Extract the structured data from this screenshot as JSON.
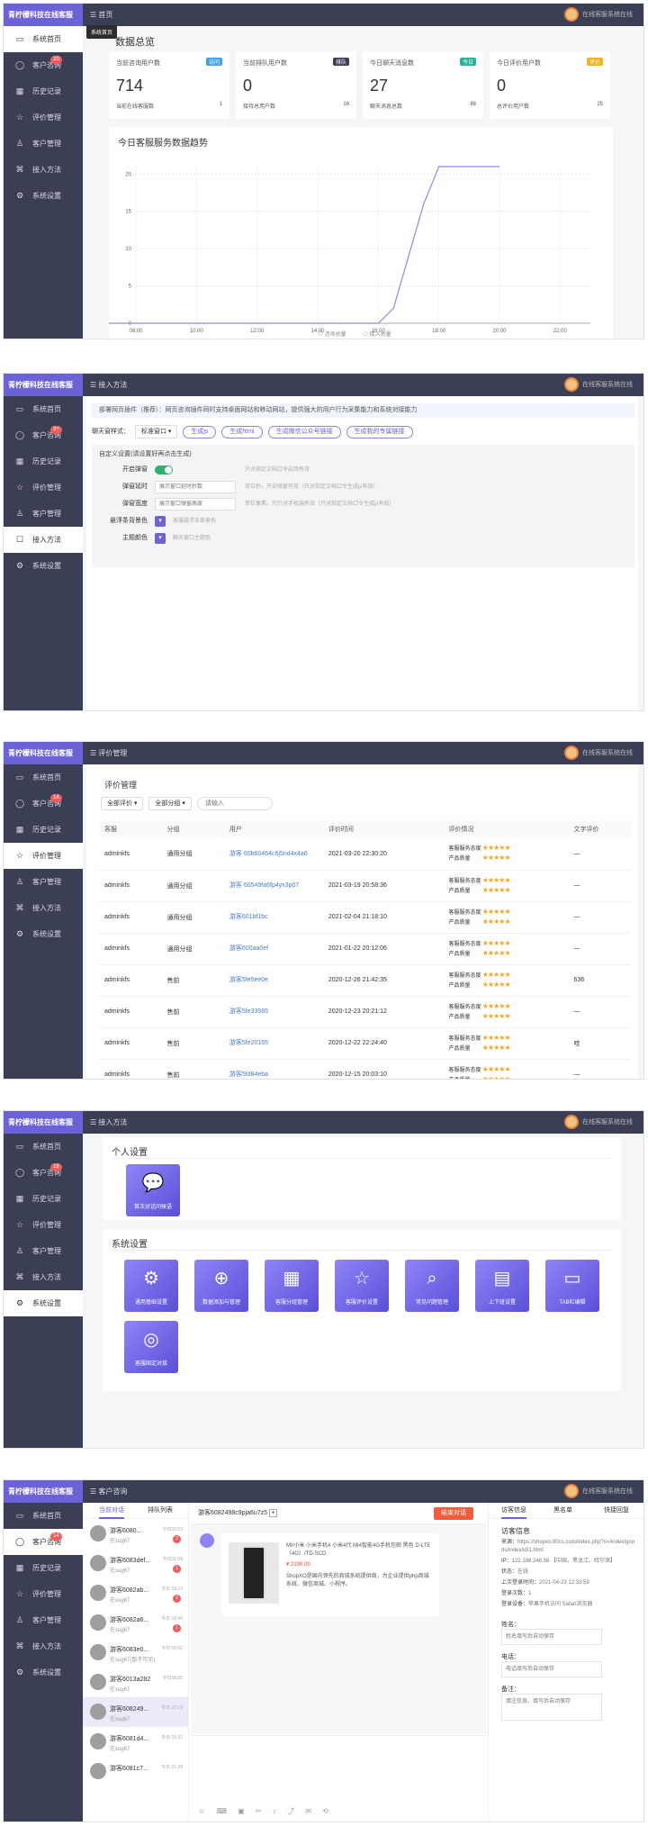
{
  "brand": "青柠檬科技在线客服",
  "user_text": "在线客服系统在线",
  "sidebar": {
    "home": "系统首页",
    "consult": "客户咨询",
    "history": "历史记录",
    "rating": "评价管理",
    "customer": "客户管理",
    "access": "接入方法",
    "settings": "系统设置",
    "badge1": "20",
    "badge2": "3+",
    "badge3": "14",
    "badge4": "18",
    "badge5": "14"
  },
  "s1": {
    "crumb": "首页",
    "tooltip": "系统首页",
    "title": "数据总览",
    "stats": [
      {
        "label": "当前咨询用户数",
        "tag": "访问",
        "value": "714",
        "sub": "当前在线客服数",
        "subval": "1",
        "tagcolor": "#41a2e6"
      },
      {
        "label": "当前排队用户数",
        "tag": "排队",
        "value": "0",
        "sub": "接待总用户数",
        "subval": "16",
        "tagcolor": "#3b3f56"
      },
      {
        "label": "今日聊天消息数",
        "tag": "今日",
        "value": "27",
        "sub": "聊天消息总数",
        "subval": "86",
        "tagcolor": "#29b099"
      },
      {
        "label": "今日评价用户数",
        "tag": "评价",
        "value": "0",
        "sub": "总评价用户数",
        "subval": "25",
        "tagcolor": "#f0b222"
      }
    ],
    "chart_title": "今日客服服务数据趋势",
    "legend_a": "咨询总量",
    "legend_b": "接入总量"
  },
  "chart_data": {
    "type": "line",
    "title": "今日客服服务数据趋势",
    "x": [
      "08:00",
      "10:00",
      "12:00",
      "14:00",
      "16:00",
      "18:00",
      "20:00",
      "22:00"
    ],
    "series": [
      {
        "name": "咨询总量",
        "points": [
          [
            0,
            0
          ],
          [
            16,
            0
          ],
          [
            16.5,
            2
          ],
          [
            17,
            9
          ],
          [
            17.5,
            16
          ],
          [
            18,
            21
          ],
          [
            20,
            21
          ]
        ]
      },
      {
        "name": "接入总量",
        "points": [
          [
            0,
            0
          ],
          [
            16,
            0
          ],
          [
            16.5,
            2
          ],
          [
            17,
            9
          ],
          [
            17.5,
            16
          ],
          [
            18,
            21
          ],
          [
            20,
            21
          ]
        ]
      }
    ],
    "yticks": [
      0,
      5,
      10,
      15,
      20
    ],
    "ylim": [
      0,
      21
    ],
    "xlim": [
      8,
      23
    ],
    "grid": true,
    "legend": "bottom"
  },
  "s2": {
    "crumb": "接入方法",
    "notice": "部署网页插件（推荐）：网页咨询插件同时支持桌面网站和移动网站，提供强大的用户行为采集能力和系统对接能力",
    "style_label": "聊天窗样式：",
    "style_value": "标准窗口",
    "buttons": [
      "生成js",
      "生成html",
      "生成微信公众号链接",
      "生成我的专属链接"
    ],
    "custom_title": "自定义设置(请设置好再点击生成)",
    "rows": [
      {
        "label": "开启弹窗",
        "value": "",
        "hint": "只对指定文档口令启用有效"
      },
      {
        "label": "弹窗延时",
        "value": "展示窗口延时秒数",
        "hint": "单位秒，开启弹窗有效（只对指定文档口令生成js有效）"
      },
      {
        "label": "弹窗宽度",
        "value": "展示窗口弹窗高度",
        "hint": "单位像素，只针对手机端有效（只对指定文档口令生成js有效）"
      },
      {
        "label": "悬浮条背景色",
        "value": "",
        "hint": "客服悬浮条背景色"
      },
      {
        "label": "主题颜色",
        "value": "",
        "hint": "聊天窗口主题色"
      }
    ]
  },
  "s3": {
    "crumb": "评价管理",
    "title": "评价管理",
    "filter1": "全部评价",
    "filter2": "全部分组",
    "search_placeholder": "请输入",
    "headers": [
      "客服",
      "分组",
      "用户",
      "评价时间",
      "评价情况",
      "文字评价"
    ],
    "crit1": "客服服务态度",
    "crit2": "产品质量",
    "rows": [
      {
        "agent": "adminkfs",
        "group": "通用分组",
        "user": "游客 60b60464c6j5nd4x4a6",
        "time": "2021-03-20 22:30:20",
        "text": "—"
      },
      {
        "agent": "adminkfs",
        "group": "通用分组",
        "user": "游客 60549fa6fp4yx3p07",
        "time": "2021-03-19 20:58:36",
        "text": "—"
      },
      {
        "agent": "adminkfs",
        "group": "通用分组",
        "user": "游客601bf1bc",
        "time": "2021-02-04 21:18:10",
        "text": "—"
      },
      {
        "agent": "adminkfs",
        "group": "通用分组",
        "user": "游客600aa0ef",
        "time": "2021-01-22 20:12:06",
        "text": "—"
      },
      {
        "agent": "adminkfs",
        "group": "售前",
        "user": "游客5fe5ee0e",
        "time": "2020-12-26 21:42:35",
        "text": "636"
      },
      {
        "agent": "adminkfs",
        "group": "售前",
        "user": "游客5fe33585",
        "time": "2020-12-23 20:21:12",
        "text": "—"
      },
      {
        "agent": "adminkfs",
        "group": "售前",
        "user": "游客5fe20165",
        "time": "2020-12-22 22:24:40",
        "text": "哇"
      },
      {
        "agent": "adminkfs",
        "group": "售前",
        "user": "游客5fd84eba",
        "time": "2020-12-15 20:03:10",
        "text": "—"
      }
    ]
  },
  "s4": {
    "crumb": "接入方法",
    "personal": "个人设置",
    "personal_tile": "首次对话问候语",
    "system": "系统设置",
    "tiles": [
      "通用基础设置",
      "数据添加与管理",
      "客服分组管理",
      "客服评价设置",
      "常见问题管理",
      "上下班设置",
      "TAB栏编辑",
      "客服固定对接"
    ]
  },
  "s5": {
    "crumb": "客户咨询",
    "tab_current": "当前对话",
    "tab_queue": "排队列表",
    "visitors": [
      {
        "name": "游客6080...",
        "time": "今日22:03",
        "msg": "在sug67",
        "badge": "2"
      },
      {
        "name": "游客6083def...",
        "time": "今日21:59",
        "msg": "在sug67",
        "badge": "1"
      },
      {
        "name": "游客6082ab...",
        "time": "今日 18:13",
        "msg": "在sug67",
        "badge": "2"
      },
      {
        "name": "游客6082a6...",
        "time": "今日 18:49",
        "msg": "在sug67",
        "badge": "1"
      },
      {
        "name": "游客6083e0...",
        "time": "今日 09:02",
        "msg": "在sug67(暂不可见)",
        "badge": ""
      },
      {
        "name": "游客6013a282",
        "time": "今日08:55",
        "msg": "在sug67",
        "badge": ""
      },
      {
        "name": "游客608249...",
        "time": "今日 22:19",
        "msg": "在sug67",
        "badge": ""
      },
      {
        "name": "游客6081d4...",
        "time": "今日 15:21",
        "msg": "在sug67",
        "badge": ""
      },
      {
        "name": "游客6081c7...",
        "time": "今日 21:38",
        "msg": "",
        "badge": ""
      }
    ],
    "chat_title": "游客6082498c9pja6u7z5",
    "end_button": "结束对话",
    "product_text": "MI/小米 小米手机4 小米4代 MI4智能4G手机包邮 黑色 D-LTE（4G）/TD-SCD",
    "price": "¥ 2100.00",
    "product_desc": "ShopXO是国内领先的商城系统提供商，为企业提供php商城系统、微信商城、小程序。",
    "info_tabs": [
      "访客信息",
      "黑名单",
      "快捷回复"
    ],
    "info_title": "访客信息",
    "fields": [
      {
        "k": "来源：",
        "v": "https://shopxo.80cs.com/index.php?s=/index/goods/index/id/1.html"
      },
      {
        "k": "IP：",
        "v": "122.198.246.56 【中国，黑龙江，哈尔滨】"
      },
      {
        "k": "状态：",
        "v": "在线"
      },
      {
        "k": "上次登录时间：",
        "v": "2021-04-23 12:33:59"
      },
      {
        "k": "登录次数：",
        "v": "1"
      },
      {
        "k": "登录设备：",
        "v": "苹果手机访问 Safari浏览器"
      }
    ],
    "name_label": "姓名：",
    "name_ph": "姓名填写后自动保存",
    "phone_label": "电话：",
    "phone_ph": "电话填写后自动保存",
    "note_label": "备注：",
    "note_ph": "填注信息、填写后自动保存"
  }
}
